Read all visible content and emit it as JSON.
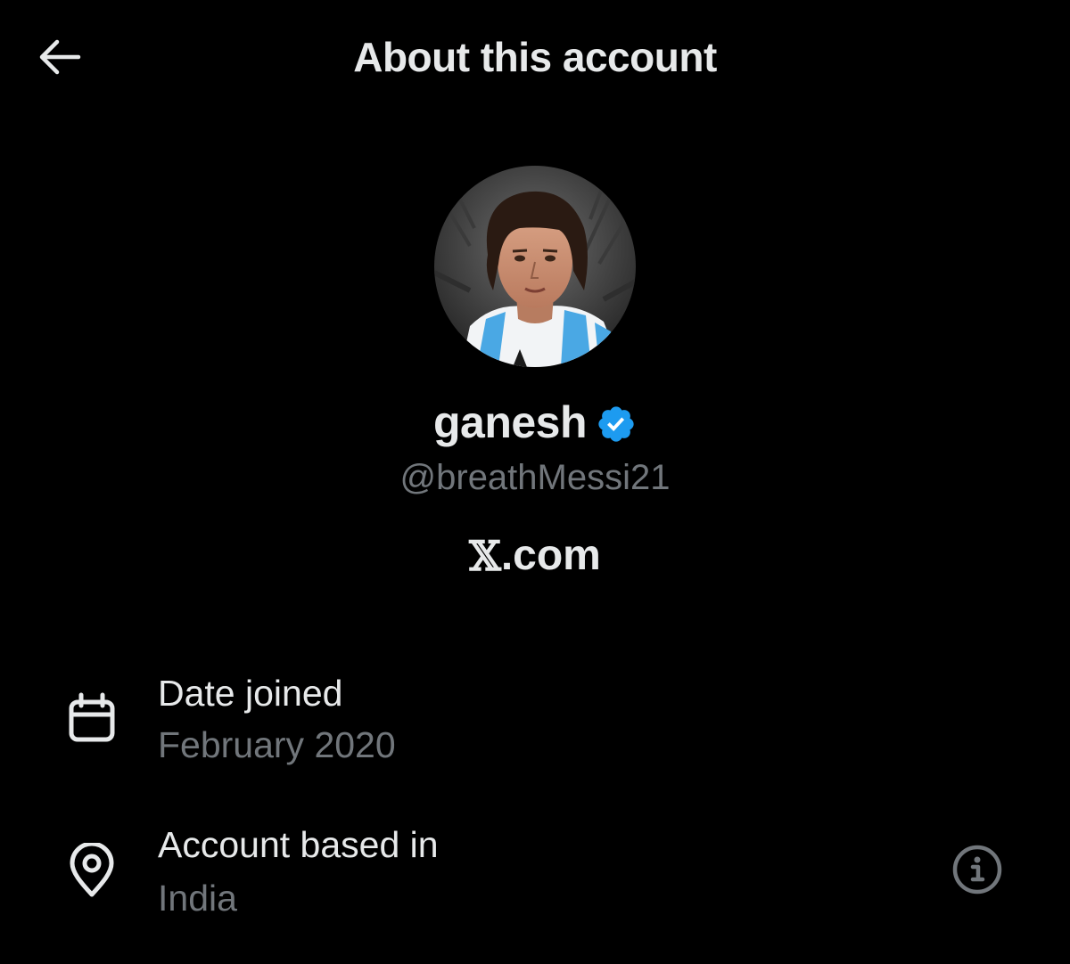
{
  "header": {
    "title": "About this account",
    "back_icon": "arrow-left-icon"
  },
  "profile": {
    "display_name": "ganesh",
    "verified": true,
    "verified_color": "#1d9bf0",
    "handle": "@breathMessi21",
    "site_prefix": "𝕏",
    "site_suffix": ".com"
  },
  "details": {
    "date_joined": {
      "icon": "calendar-icon",
      "label": "Date joined",
      "value": "February 2020"
    },
    "location": {
      "icon": "location-pin-icon",
      "label": "Account based in",
      "value": "India",
      "info_icon": "info-circle-icon"
    }
  },
  "colors": {
    "background": "#000000",
    "primary_text": "#e7e9ea",
    "secondary_text": "#71767b",
    "accent": "#1d9bf0"
  }
}
